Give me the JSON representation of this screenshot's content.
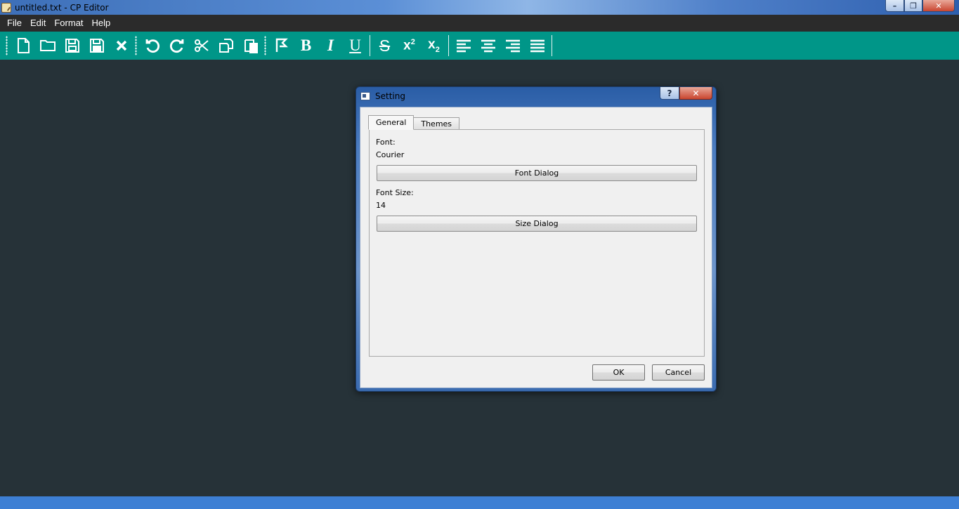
{
  "window": {
    "title": "untitled.txt - CP Editor",
    "controls": [
      "–",
      "❐",
      "✕"
    ]
  },
  "menu": {
    "items": [
      "File",
      "Edit",
      "Format",
      "Help"
    ]
  },
  "toolbar": {
    "bold": "B",
    "italic": "I",
    "underline": "U",
    "strike": "S",
    "superscript_base": "x",
    "superscript_exp": "2",
    "subscript_base": "x",
    "subscript_exp": "2"
  },
  "dialog": {
    "title": "Setting",
    "help_label": "?",
    "close_label": "✕",
    "tabs": [
      "General",
      "Themes"
    ],
    "font_label": "Font:",
    "font_value": "Courier",
    "font_button": "Font Dialog",
    "size_label": "Font Size:",
    "size_value": "14",
    "size_button": "Size Dialog",
    "ok_label": "OK",
    "cancel_label": "Cancel"
  },
  "colors": {
    "toolbar_bg": "#009688",
    "editor_bg": "#263238",
    "menubar_bg": "#2b2b2b"
  }
}
